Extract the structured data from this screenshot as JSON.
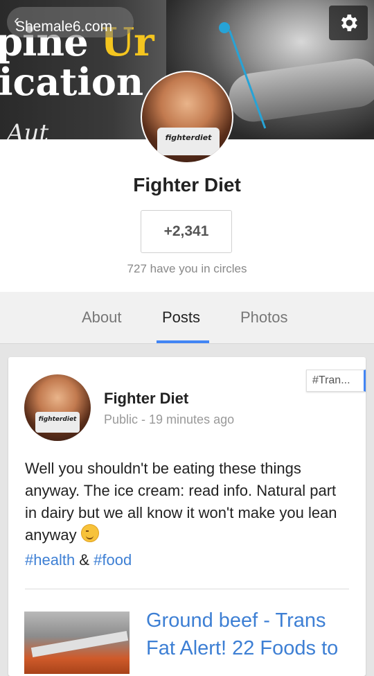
{
  "banner": {
    "text_line1_a": "pine",
    "text_line1_b": "Ur",
    "text_line2": "ication",
    "scribble": "Aut"
  },
  "top_bar": {
    "back_icon": "back-arrow-icon",
    "watermark": "Shemale6.com",
    "settings_icon": "gear-icon"
  },
  "profile": {
    "avatar_logo": "fighterdiet",
    "name": "Fighter Diet",
    "plus_count": "+2,341",
    "circles_text": "727 have you in circles"
  },
  "tabs": [
    {
      "label": "About",
      "active": false
    },
    {
      "label": "Posts",
      "active": true
    },
    {
      "label": "Photos",
      "active": false
    }
  ],
  "post": {
    "tag_chip": "#Tran...",
    "avatar_logo": "fighterdiet",
    "author": "Fighter Diet",
    "meta": "Public - 19 minutes ago",
    "text": "Well you shouldn't be eating these things anyway. The ice cream: read info. Natural part in dairy but we all know it won't make you lean anyway",
    "hashtag1": "#health",
    "hashtag_sep": "&",
    "hashtag2": "#food",
    "link_title": "Ground beef - Trans Fat Alert! 22 Foods to"
  },
  "colors": {
    "accent": "#4285f4",
    "link": "#3d7fd4"
  }
}
